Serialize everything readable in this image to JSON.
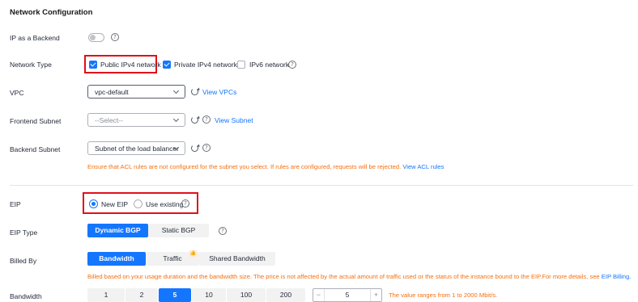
{
  "section_title": "Network Configuration",
  "labels": {
    "ip_backend": "IP as a Backend",
    "network_type": "Network Type",
    "vpc": "VPC",
    "frontend_subnet": "Frontend Subnet",
    "backend_subnet": "Backend Subnet",
    "eip": "EIP",
    "eip_type": "EIP Type",
    "billed_by": "Billed By",
    "bandwidth": "Bandwidth"
  },
  "help_glyph": "?",
  "network_type": {
    "options": [
      {
        "label": "Public IPv4 network",
        "checked": true
      },
      {
        "label": "Private IPv4 network",
        "checked": true
      },
      {
        "label": "IPv6 network",
        "checked": false
      }
    ]
  },
  "vpc": {
    "value": "vpc-default",
    "link": "View VPCs"
  },
  "frontend_subnet": {
    "placeholder": "--Select--",
    "link": "View Subnet"
  },
  "backend_subnet": {
    "value": "Subnet of the load balancer",
    "warning": "Ensure that ACL rules are not configured for the subnet you select. If rules are configured, requests will be rejected.",
    "warning_link": "View ACL rules"
  },
  "eip": {
    "options": [
      {
        "label": "New EIP",
        "selected": true
      },
      {
        "label": "Use existing",
        "selected": false
      }
    ]
  },
  "eip_type": {
    "options": [
      "Dynamic BGP",
      "Static BGP"
    ],
    "selected": "Dynamic BGP"
  },
  "billed_by": {
    "options": [
      "Bandwidth",
      "Traffic",
      "Shared Bandwidth"
    ],
    "selected": "Bandwidth",
    "traffic_badge": "👍",
    "info": "Billed based on your usage duration and the bandwidth size. The price is not affected by the actual amount of traffic used or the status of the instance bound to the EIP.For more details, see",
    "info_link": "EIP Billing."
  },
  "bandwidth": {
    "options": [
      "1",
      "2",
      "5",
      "10",
      "100",
      "200"
    ],
    "selected": "5",
    "stepper": {
      "minus": "−",
      "value": "5",
      "plus": "+"
    },
    "range_note": "The value ranges from 1 to 2000 Mbit/s."
  },
  "colors": {
    "accent": "#1476ff",
    "warning": "#f66f0e",
    "highlight_box": "#e0101a"
  }
}
